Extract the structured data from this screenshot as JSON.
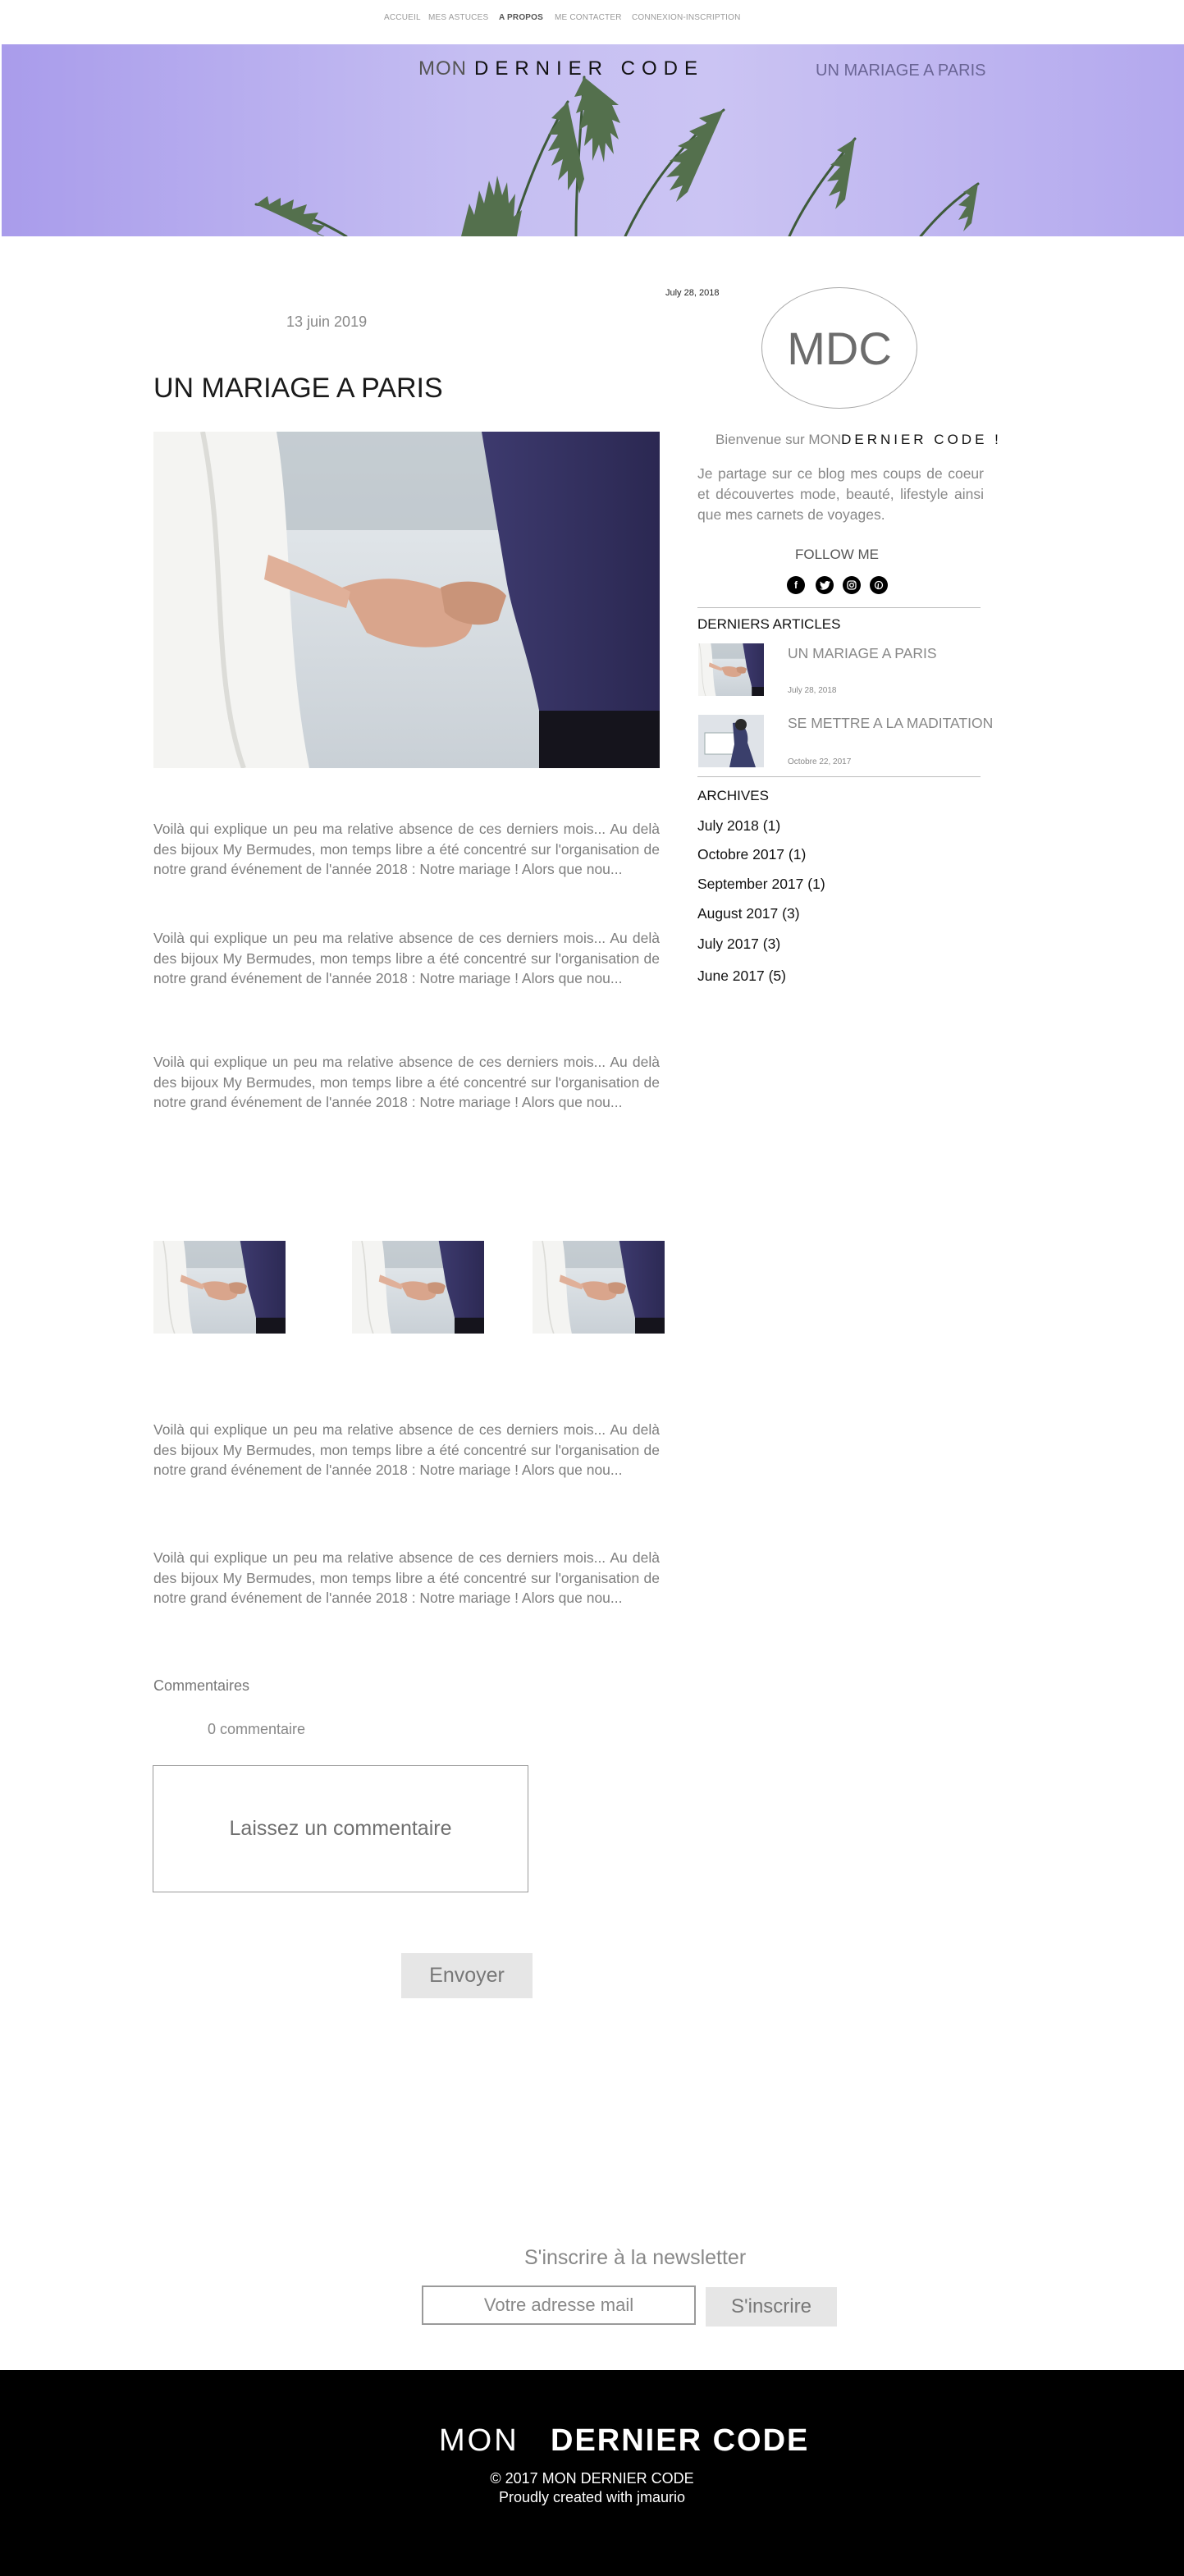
{
  "nav": {
    "items": [
      {
        "label": "ACCUEIL"
      },
      {
        "label": "MES ASTUCES"
      },
      {
        "label": "A PROPOS"
      },
      {
        "label": "ME CONTACTER"
      },
      {
        "label": "CONNEXION-INSCRIPTION"
      }
    ],
    "active": "A PROPOS"
  },
  "header": {
    "brand_prefix": "MON",
    "brand_name": "DERNIER CODE",
    "current_post": "UN MARIAGE A PARIS"
  },
  "post": {
    "date": "13 juin 2019",
    "title": "UN MARIAGE A PARIS",
    "paragraphs": [
      "Voilà qui explique un peu ma relative absence de ces derniers mois... Au delà des bijoux My Bermudes, mon temps libre a été concentré sur l'organisation de notre grand événement de l'année 2018 : Notre mariage ! Alors que nou...",
      "Voilà qui explique un peu ma relative absence de ces derniers mois... Au delà des bijoux My Bermudes, mon temps libre a été concentré sur l'organisation de notre grand événement de l'année 2018 : Notre mariage ! Alors que nou...",
      "Voilà qui explique un peu ma relative absence de ces derniers mois... Au delà des bijoux My Bermudes, mon temps libre a été concentré sur l'organisation de notre grand événement de l'année 2018 : Notre mariage ! Alors que nou...",
      "Voilà qui explique un peu ma relative absence de ces derniers mois... Au delà des bijoux My Bermudes, mon temps libre a été concentré sur l'organisation de notre grand événement de l'année 2018 : Notre mariage ! Alors que nou...",
      "Voilà qui explique un peu ma relative absence de ces derniers mois... Au delà des bijoux My Bermudes, mon temps libre a été concentré sur l'organisation de notre grand événement de l'année 2018 : Notre mariage ! Alors que nou..."
    ]
  },
  "comments": {
    "heading": "Commentaires",
    "count": "0 commentaire",
    "placeholder": "Laissez un commentaire",
    "submit": "Envoyer"
  },
  "sidebar": {
    "date": "July 28, 2018",
    "logo": "MDC",
    "welcome_prefix": "Bienvenue sur MON",
    "welcome_brand": "DERNIER CODE !",
    "intro": "Je partage sur ce blog mes coups de coeur et découvertes mode, beauté, lifestyle ainsi que mes carnets de voyages.",
    "follow": "FOLLOW ME",
    "social": [
      "facebook-icon",
      "twitter-icon",
      "instagram-icon",
      "pinterest-icon"
    ],
    "latest_heading": "DERNIERS ARTICLES",
    "latest": [
      {
        "title": "UN MARIAGE A PARIS",
        "date": "July 28, 2018"
      },
      {
        "title": "SE METTRE A LA MADITATION",
        "date": "Octobre 22, 2017"
      }
    ],
    "archives_heading": "ARCHIVES",
    "archives": [
      "July 2018 (1)",
      "Octobre 2017 (1)",
      "September 2017 (1)",
      "August 2017 (3)",
      "July 2017 (3)",
      "June 2017 (5)"
    ]
  },
  "newsletter": {
    "title": "S'inscrire à la newsletter",
    "placeholder": "Votre adresse mail",
    "button": "S'inscrire"
  },
  "footer": {
    "brand_prefix": "MON",
    "brand_name": "DERNIER CODE",
    "copyright": "© 2017 MON DERNIER CODE",
    "credit": "Proudly created with jmaurio"
  },
  "colors": {
    "banner": "#b9b0f0",
    "footer": "#000000",
    "button": "#e6e6e6"
  }
}
